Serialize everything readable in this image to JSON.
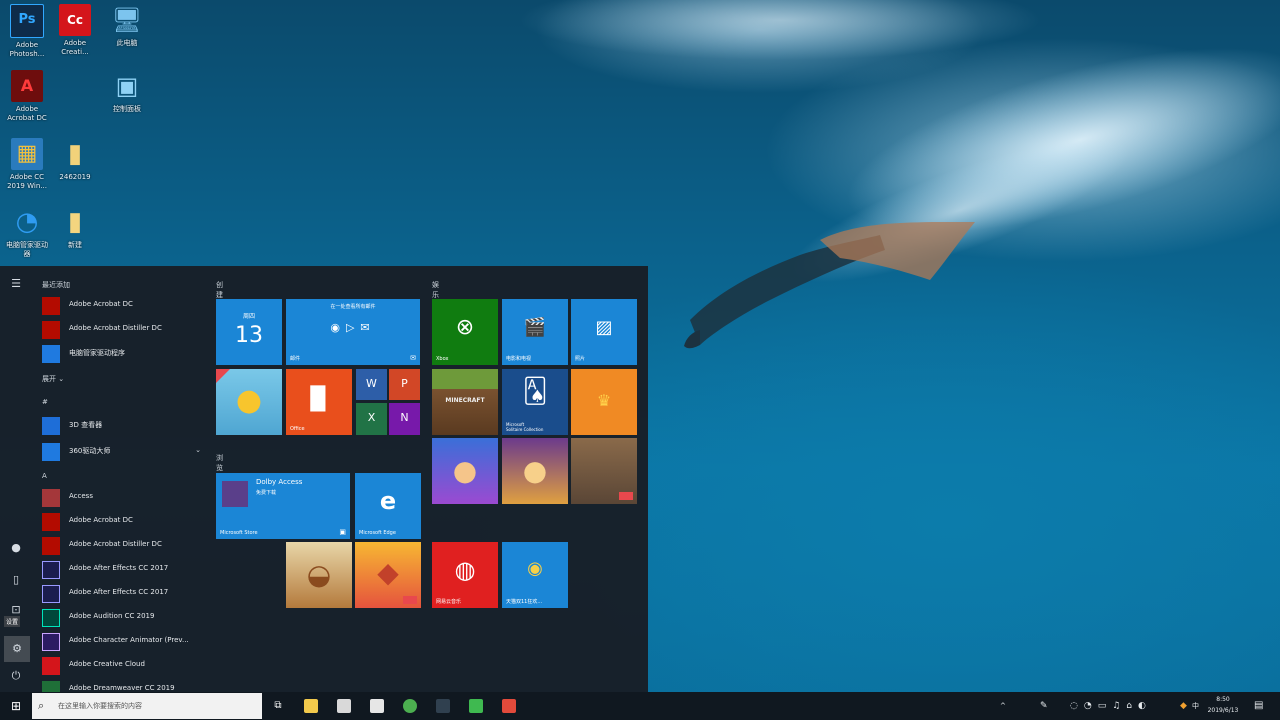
{
  "desktop": {
    "icons": [
      {
        "label": "Adobe\nPhotosh...",
        "glyph": "Ps",
        "color": "#0e2c4a",
        "fg": "#31a8ff"
      },
      {
        "label": "Adobe\nCreati...",
        "glyph": "Cc",
        "color": "#d4151b",
        "fg": "#ffffff"
      },
      {
        "label": "此电脑",
        "glyph": "🖥",
        "color": "transparent",
        "fg": "#7cc4ee"
      },
      {
        "label": "Adobe\nAcrobat DC",
        "glyph": "A",
        "color": "#6e0d0d",
        "fg": "#ff3b3b"
      },
      {
        "label": "控制面板",
        "glyph": "▣",
        "color": "transparent",
        "fg": "#8fd2f5"
      },
      {
        "label": "Adobe CC\n2019 Win...",
        "glyph": "▦",
        "color": "#2a7bbd",
        "fg": "#f0c040"
      },
      {
        "label": "2462019",
        "glyph": "▮",
        "color": "transparent",
        "fg": "#f1d27a"
      },
      {
        "label": "电脑管家驱动\n器",
        "glyph": "◔",
        "color": "transparent",
        "fg": "#2f9cf2"
      },
      {
        "label": "新建",
        "glyph": "▮",
        "color": "transparent",
        "fg": "#f3d57f"
      }
    ]
  },
  "start_menu": {
    "rail_icons": [
      "hamburger-icon",
      "user-icon",
      "document-icon",
      "pictures-icon",
      "settings-icon",
      "power-icon"
    ],
    "rail_tooltip": "设置",
    "list": {
      "recent_header": "最近添加",
      "recent": [
        {
          "label": "Adobe Acrobat DC",
          "color": "#b30b00"
        },
        {
          "label": "Adobe Acrobat Distiller DC",
          "color": "#b30b00"
        },
        {
          "label": "电脑管家驱动程序",
          "color": "#1f7ae0"
        }
      ],
      "expand_label": "展开 ⌄",
      "hash_header": "#",
      "hash_items": [
        {
          "label": "3D 查看器",
          "color": "#1e6ed8"
        },
        {
          "label": "360驱动大师",
          "color": "#1f7ae0"
        }
      ],
      "a_header": "A",
      "a_items": [
        {
          "label": "Access",
          "color": "#a4373a"
        },
        {
          "label": "Adobe Acrobat DC",
          "color": "#b30b00"
        },
        {
          "label": "Adobe Acrobat Distiller DC",
          "color": "#b30b00"
        },
        {
          "label": "Adobe After Effects CC 2017",
          "color": "#1b1d4e"
        },
        {
          "label": "Adobe After Effects CC 2017",
          "color": "#1b1d4e"
        },
        {
          "label": "Adobe Audition CC 2019",
          "color": "#00473b"
        },
        {
          "label": "Adobe Character Animator (Prev...",
          "color": "#2b1b63"
        },
        {
          "label": "Adobe Creative Cloud",
          "color": "#d4151b"
        },
        {
          "label": "Adobe Dreamweaver CC 2019",
          "color": "#1f6f38"
        }
      ]
    },
    "groups": {
      "create": "创建",
      "play": "娱乐",
      "browse": "浏览"
    },
    "tiles": {
      "calendar_day": "周四",
      "calendar_date": "13",
      "mail_text": "在一处查看所有邮件",
      "mail_label": "邮件",
      "office_label": "Office",
      "xbox_label": "Xbox",
      "movies_label": "电影和电视",
      "photos_label": "照片",
      "minecraft_text": "MINECRAFT",
      "solitaire_label": "Microsoft\nSolitaire Collection",
      "dolby_title": "Dolby Access",
      "dolby_sub": "免费下载",
      "store_label": "Microsoft Store",
      "edge_label": "Microsoft Edge",
      "netease_label": "网易云音乐",
      "tmall_label": "天猫双11狂欢..."
    }
  },
  "taskbar": {
    "search_placeholder": "在这里输入你要搜索的内容",
    "pinned": [
      {
        "name": "file-explorer",
        "color": "#f2c94c"
      },
      {
        "name": "store",
        "color": "#d9d9d9"
      },
      {
        "name": "mail",
        "color": "#e6e6e6"
      },
      {
        "name": "chrome",
        "color": "#4caf50"
      },
      {
        "name": "screen",
        "color": "#30404f"
      },
      {
        "name": "camtasia",
        "color": "#3fb950"
      },
      {
        "name": "app",
        "color": "#e24a3b"
      }
    ],
    "tray_text": "^",
    "ime_text": "中",
    "clock_time": "8:50",
    "clock_date": "2019/6/13"
  }
}
